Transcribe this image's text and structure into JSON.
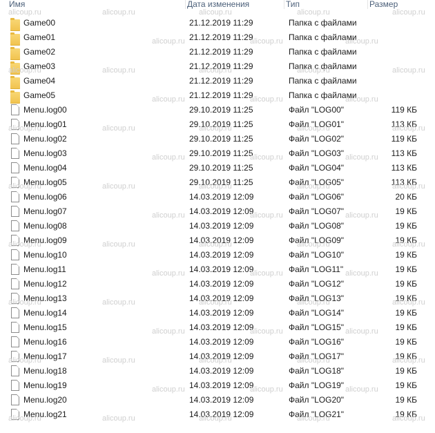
{
  "columns": {
    "name": "Имя",
    "date": "Дата изменения",
    "type": "Тип",
    "size": "Размер"
  },
  "watermark": "alicoup.ru",
  "files": [
    {
      "name": "Game00",
      "date": "21.12.2019 11:29",
      "type": "Папка с файлами",
      "size": "",
      "icon": "folder-icon"
    },
    {
      "name": "Game01",
      "date": "21.12.2019 11:29",
      "type": "Папка с файлами",
      "size": "",
      "icon": "folder-icon"
    },
    {
      "name": "Game02",
      "date": "21.12.2019 11:29",
      "type": "Папка с файлами",
      "size": "",
      "icon": "folder-icon"
    },
    {
      "name": "Game03",
      "date": "21.12.2019 11:29",
      "type": "Папка с файлами",
      "size": "",
      "icon": "folder-icon"
    },
    {
      "name": "Game04",
      "date": "21.12.2019 11:29",
      "type": "Папка с файлами",
      "size": "",
      "icon": "folder-icon"
    },
    {
      "name": "Game05",
      "date": "21.12.2019 11:29",
      "type": "Папка с файлами",
      "size": "",
      "icon": "folder-icon"
    },
    {
      "name": "Menu.log00",
      "date": "29.10.2019 11:25",
      "type": "Файл \"LOG00\"",
      "size": "119 КБ",
      "icon": "file-icon"
    },
    {
      "name": "Menu.log01",
      "date": "29.10.2019 11:25",
      "type": "Файл \"LOG01\"",
      "size": "113 КБ",
      "icon": "file-icon"
    },
    {
      "name": "Menu.log02",
      "date": "29.10.2019 11:25",
      "type": "Файл \"LOG02\"",
      "size": "119 КБ",
      "icon": "file-icon"
    },
    {
      "name": "Menu.log03",
      "date": "29.10.2019 11:25",
      "type": "Файл \"LOG03\"",
      "size": "113 КБ",
      "icon": "file-icon"
    },
    {
      "name": "Menu.log04",
      "date": "29.10.2019 11:25",
      "type": "Файл \"LOG04\"",
      "size": "113 КБ",
      "icon": "file-icon"
    },
    {
      "name": "Menu.log05",
      "date": "29.10.2019 11:25",
      "type": "Файл \"LOG05\"",
      "size": "113 КБ",
      "icon": "file-icon"
    },
    {
      "name": "Menu.log06",
      "date": "14.03.2019 12:09",
      "type": "Файл \"LOG06\"",
      "size": "20 КБ",
      "icon": "file-icon"
    },
    {
      "name": "Menu.log07",
      "date": "14.03.2019 12:09",
      "type": "Файл \"LOG07\"",
      "size": "19 КБ",
      "icon": "file-icon"
    },
    {
      "name": "Menu.log08",
      "date": "14.03.2019 12:09",
      "type": "Файл \"LOG08\"",
      "size": "19 КБ",
      "icon": "file-icon"
    },
    {
      "name": "Menu.log09",
      "date": "14.03.2019 12:09",
      "type": "Файл \"LOG09\"",
      "size": "19 КБ",
      "icon": "file-icon"
    },
    {
      "name": "Menu.log10",
      "date": "14.03.2019 12:09",
      "type": "Файл \"LOG10\"",
      "size": "19 КБ",
      "icon": "file-icon"
    },
    {
      "name": "Menu.log11",
      "date": "14.03.2019 12:09",
      "type": "Файл \"LOG11\"",
      "size": "19 КБ",
      "icon": "file-icon"
    },
    {
      "name": "Menu.log12",
      "date": "14.03.2019 12:09",
      "type": "Файл \"LOG12\"",
      "size": "19 КБ",
      "icon": "file-icon"
    },
    {
      "name": "Menu.log13",
      "date": "14.03.2019 12:09",
      "type": "Файл \"LOG13\"",
      "size": "19 КБ",
      "icon": "file-icon"
    },
    {
      "name": "Menu.log14",
      "date": "14.03.2019 12:09",
      "type": "Файл \"LOG14\"",
      "size": "19 КБ",
      "icon": "file-icon"
    },
    {
      "name": "Menu.log15",
      "date": "14.03.2019 12:09",
      "type": "Файл \"LOG15\"",
      "size": "19 КБ",
      "icon": "file-icon"
    },
    {
      "name": "Menu.log16",
      "date": "14.03.2019 12:09",
      "type": "Файл \"LOG16\"",
      "size": "19 КБ",
      "icon": "file-icon"
    },
    {
      "name": "Menu.log17",
      "date": "14.03.2019 12:09",
      "type": "Файл \"LOG17\"",
      "size": "19 КБ",
      "icon": "file-icon"
    },
    {
      "name": "Menu.log18",
      "date": "14.03.2019 12:09",
      "type": "Файл \"LOG18\"",
      "size": "19 КБ",
      "icon": "file-icon"
    },
    {
      "name": "Menu.log19",
      "date": "14.03.2019 12:09",
      "type": "Файл \"LOG19\"",
      "size": "19 КБ",
      "icon": "file-icon"
    },
    {
      "name": "Menu.log20",
      "date": "14.03.2019 12:09",
      "type": "Файл \"LOG20\"",
      "size": "19 КБ",
      "icon": "file-icon"
    },
    {
      "name": "Menu.log21",
      "date": "14.03.2019 12:09",
      "type": "Файл \"LOG21\"",
      "size": "19 КБ",
      "icon": "file-icon"
    }
  ]
}
